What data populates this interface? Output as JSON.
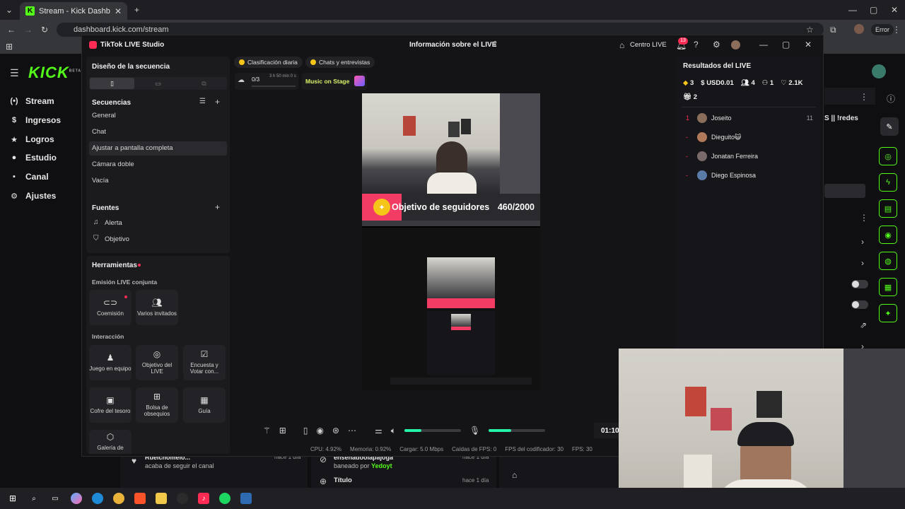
{
  "browser": {
    "tab_title": "Stream - Kick Dashboard",
    "url": "dashboard.kick.com/stream",
    "error_label": "Error"
  },
  "kick": {
    "logo": "KICK",
    "logo_badge": "BETA",
    "nav": [
      {
        "icon": "(•)",
        "label": "Stream"
      },
      {
        "icon": "$",
        "label": "Ingresos"
      },
      {
        "icon": "★",
        "label": "Logros"
      },
      {
        "icon": "●",
        "label": "Estudio"
      },
      {
        "icon": "▪",
        "label": "Canal"
      },
      {
        "icon": "⚙",
        "label": "Ajustes"
      }
    ],
    "partial_title": "S || !redes",
    "feed": [
      {
        "user": "Ruelchomelo...",
        "text": "acaba de seguir el canal",
        "time": "hace 1 día"
      },
      {
        "user": "enseñadoolapajoga",
        "text": "baneado por",
        "by": "Yedoyt",
        "time": "hace 1 día"
      },
      {
        "user": "Título",
        "text": "",
        "time": "hace 1 día"
      }
    ]
  },
  "tiktok": {
    "app_title": "TikTok LIVE Studio",
    "center_title": "Información sobre el LIVE",
    "live_center": "Centro LIVE",
    "notif_count": "13",
    "left": {
      "scene_design": "Diseño de la secuencia",
      "sequences_title": "Secuencias",
      "sequences": [
        "General",
        "Chat",
        "Ajustar a pantalla completa",
        "Cámara doble",
        "Vacía"
      ],
      "sources_title": "Fuentes",
      "sources": [
        "Alerta",
        "Objetivo"
      ],
      "tools_title": "Herramientas",
      "joint_title": "Emisión LIVE conjunta",
      "joint_tools": [
        "Coemisión",
        "Varios invitados"
      ],
      "interaction_title": "Interacción",
      "interaction_tools": [
        "Juego en equipo",
        "Objetivo del LIVE",
        "Encuesta y Votar con...",
        "Cofre del tesoro",
        "Bolsa de obsequios",
        "Guía",
        "Galería de"
      ]
    },
    "top_chips": {
      "ranking": "Clasificación diaria",
      "chats": "Chats y entrevistas",
      "progress": "0/3",
      "time_left": "3 h 50 min 0 s",
      "music": "Music on Stage"
    },
    "goal": {
      "label": "Objetivo de seguidores",
      "value": "460/2000"
    },
    "results": {
      "title": "Resultados del LIVE",
      "diamonds": "3",
      "usd": "USD0.01",
      "viewers": "4",
      "new_followers": "1",
      "likes": "2.1K",
      "gifters": "2",
      "rows": [
        {
          "rank": "1",
          "name": "Joseito",
          "score": "11"
        },
        {
          "rank": "-",
          "name": "Dieguito😺",
          "score": ""
        },
        {
          "rank": "-",
          "name": "Jonatan Ferreira",
          "score": ""
        },
        {
          "rank": "-",
          "name": "Diego Espinosa",
          "score": ""
        }
      ]
    },
    "controls": {
      "timer": "01:10",
      "volume_level": 0.3,
      "mic_level": 0.4
    },
    "stats": {
      "cpu": "CPU: 4.92%",
      "memory": "Memoria: 0.92%",
      "load": "Cargar: 5.0 Mbps",
      "fps_drops": "Caídas de FPS: 0",
      "encoder_fps": "FPS del codificador: 30",
      "fps": "FPS: 30"
    }
  }
}
